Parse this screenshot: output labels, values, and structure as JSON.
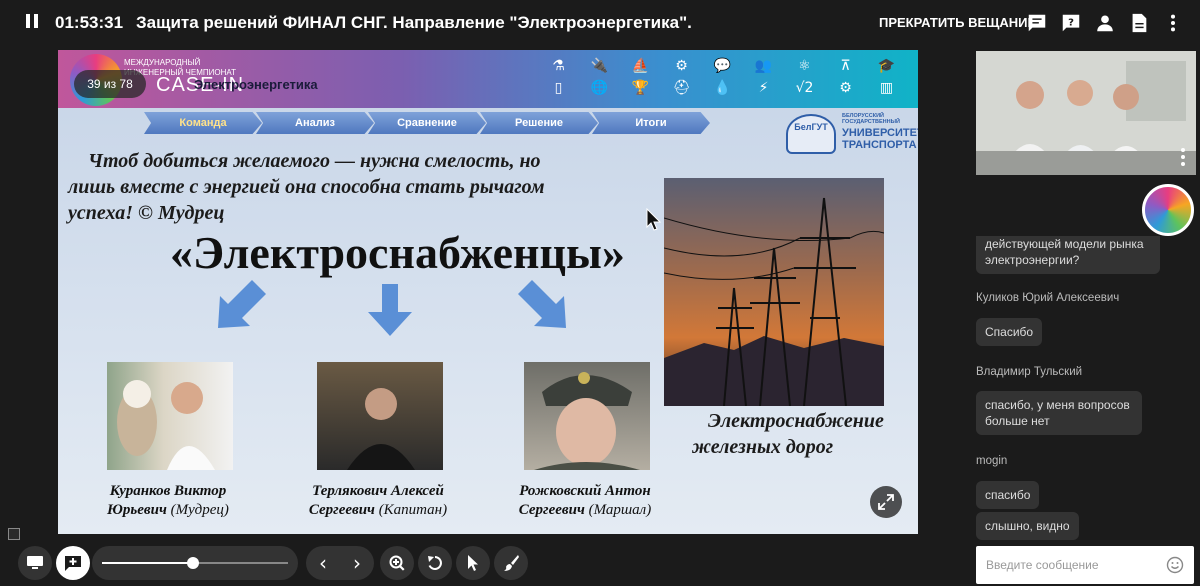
{
  "header": {
    "timer": "01:53:31",
    "title": "Защита решений ФИНАЛ СНГ. Направление \"Электроэнергетика\".",
    "stop_label": "ПРЕКРАТИТЬ ВЕЩАНИЕ"
  },
  "slide": {
    "page_indicator": "39 из 78",
    "logo_text_line1": "МЕЖДУНАРОДНЫЙ",
    "logo_text_line2": "ИНЖЕНЕРНЫЙ ЧЕМПИОНАТ",
    "logo_text_big": "CASE-IN",
    "direction_label": "Электроэнергетика",
    "steps": [
      "Команда",
      "Анализ",
      "Сравнение",
      "Решение",
      "Итоги"
    ],
    "university": {
      "emblem": "БелГУТ",
      "small": "БЕЛОРУССКИЙ ГОСУДАРСТВЕННЫЙ",
      "big_line1": "УНИВЕРСИТЕТ",
      "big_line2": "ТРАНСПОРТА"
    },
    "quote": "Чтоб добиться желаемого — нужна смелость, но лишь вместе с энергией она способна стать рычагом успеха! © Мудрец",
    "team_name": "«Электроснабженцы»",
    "image_caption_line1": "Электроснабжение",
    "image_caption_line2": "железных дорог",
    "members": [
      {
        "name_line1": "Куранков Виктор",
        "name_line2": "Юрьевич",
        "role": "(Мудрец)"
      },
      {
        "name_line1": "Терлякович Алексей",
        "name_line2": "Сергеевич",
        "role": "(Капитан)"
      },
      {
        "name_line1": "Рожковский Антон",
        "name_line2": "Сергеевич",
        "role": "(Маршал)"
      }
    ]
  },
  "chat": {
    "partial_message": "действующей модели рынка электроэнергии?",
    "messages": [
      {
        "author": "Куликов Юрий Алексеевич",
        "texts": [
          "Спасибо"
        ]
      },
      {
        "author": "Владимир Тульский",
        "texts": [
          "спасибо, у меня вопросов больше нет"
        ]
      },
      {
        "author": "mogin",
        "texts": [
          "спасибо",
          "слышно, видно"
        ]
      }
    ],
    "input_placeholder": "Введите сообщение"
  },
  "player": {
    "progress": 0.49
  },
  "icons": {
    "top": [
      "chat-icon",
      "question-icon",
      "person-icon",
      "document-icon",
      "more-vert-icon"
    ],
    "bottom": [
      "presentation-icon",
      "add-slide-icon",
      "zoom-icon",
      "undo-icon",
      "pointer-icon",
      "brush-icon"
    ]
  },
  "colors": {
    "background": "#1b1b1b",
    "panel": "#333333",
    "step_blue": "#4f78bf",
    "step_active_text": "#ffe28a"
  }
}
